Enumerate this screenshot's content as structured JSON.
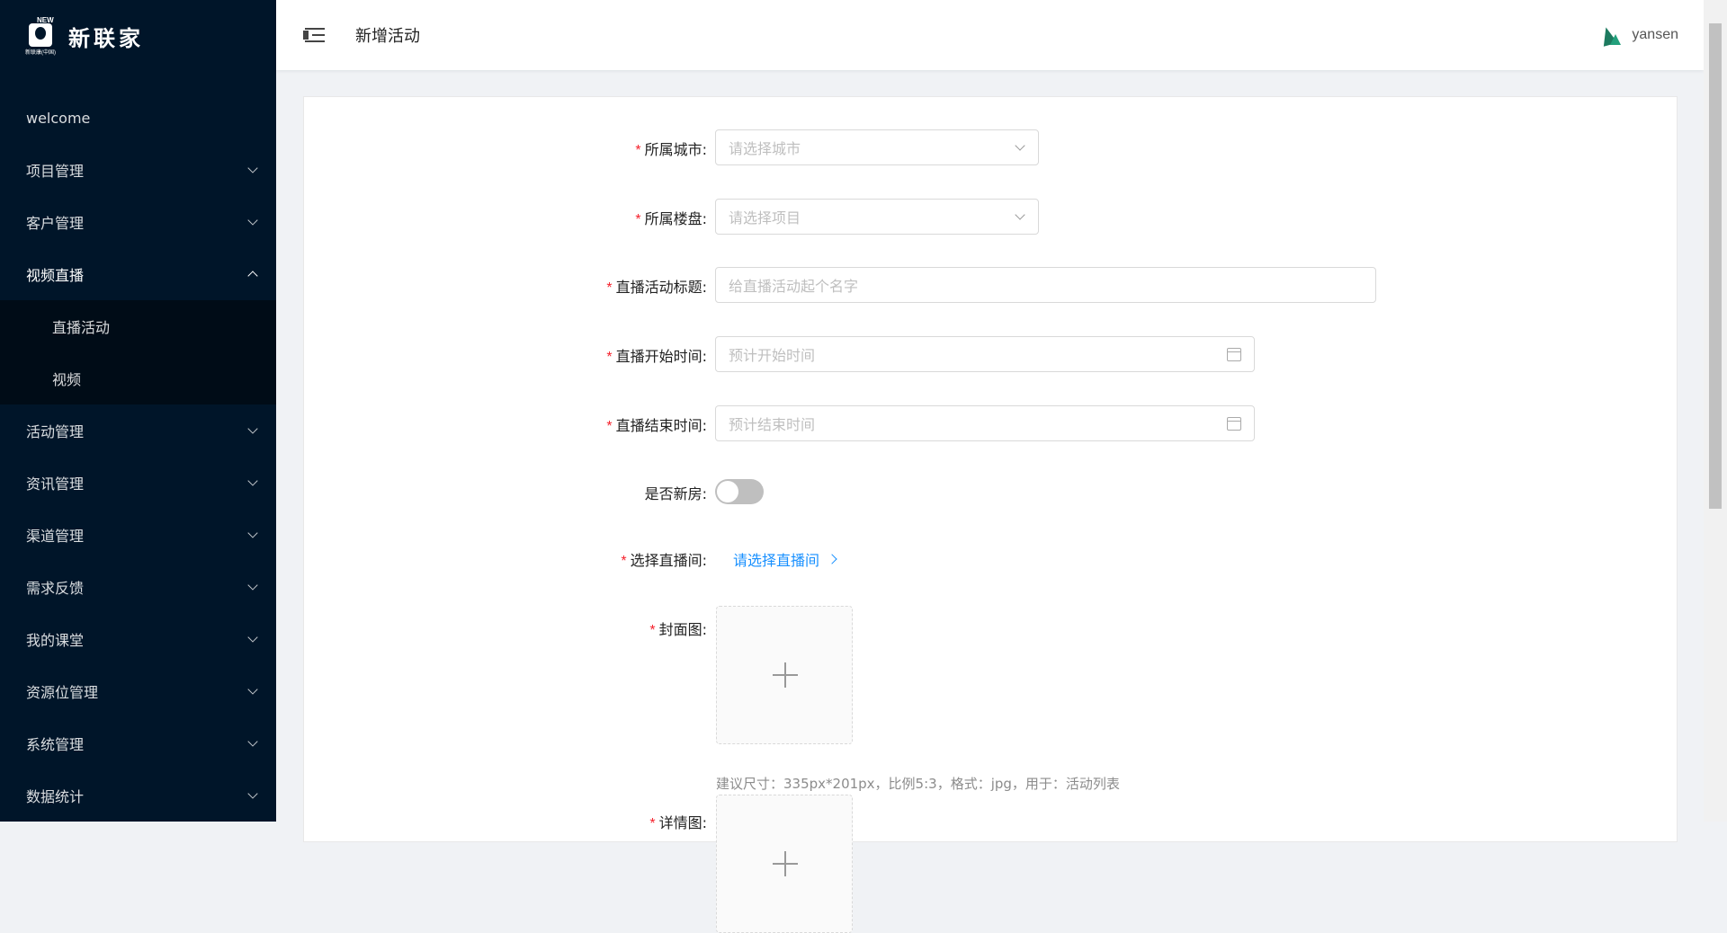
{
  "app": {
    "logo_new": "NEW",
    "logo_sub": "新联康(中国)",
    "logo_text": "新联家"
  },
  "sidebar": {
    "items": [
      {
        "label": "welcome"
      },
      {
        "label": "项目管理"
      },
      {
        "label": "客户管理"
      },
      {
        "label": "视频直播"
      },
      {
        "label": "活动管理"
      },
      {
        "label": "资讯管理"
      },
      {
        "label": "渠道管理"
      },
      {
        "label": "需求反馈"
      },
      {
        "label": "我的课堂"
      },
      {
        "label": "资源位管理"
      },
      {
        "label": "系统管理"
      },
      {
        "label": "数据统计"
      }
    ],
    "sub_items": [
      {
        "label": "直播活动"
      },
      {
        "label": "视频"
      }
    ]
  },
  "header": {
    "title": "新增活动",
    "username": "yansen"
  },
  "form": {
    "required_mark": "*",
    "city": {
      "label": "所属城市:",
      "placeholder": "请选择城市"
    },
    "project": {
      "label": "所属楼盘:",
      "placeholder": "请选择项目"
    },
    "title": {
      "label": "直播活动标题:",
      "placeholder": "给直播活动起个名字"
    },
    "start": {
      "label": "直播开始时间:",
      "placeholder": "预计开始时间"
    },
    "end": {
      "label": "直播结束时间:",
      "placeholder": "预计结束时间"
    },
    "new_house": {
      "label": "是否新房:",
      "checked": false
    },
    "room": {
      "label": "选择直播间:",
      "link": "请选择直播间"
    },
    "cover": {
      "label": "封面图:",
      "hint": "建议尺寸：335px*201px，比例5:3，格式：jpg，用于：活动列表"
    },
    "detail": {
      "label": "详情图:"
    }
  },
  "colors": {
    "sidebar_bg": "#001529",
    "primary": "#1890ff",
    "required": "#f5222d"
  }
}
